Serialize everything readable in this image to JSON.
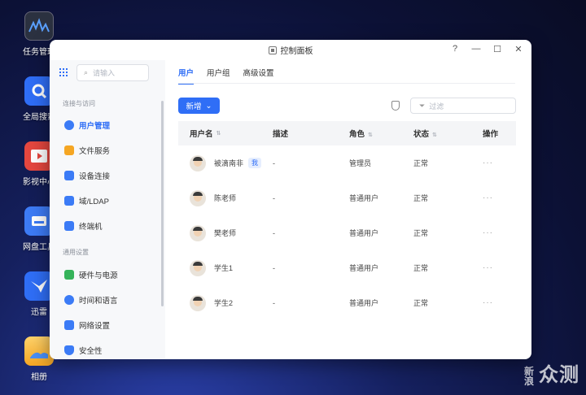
{
  "desktop": {
    "icons": [
      {
        "label": "任务管理",
        "color": "#2b3140"
      },
      {
        "label": "全局搜索",
        "color": "#2f6ef6"
      },
      {
        "label": "影视中心",
        "color": "#e4473f"
      },
      {
        "label": "网盘工具",
        "color": "#3d7bf5"
      },
      {
        "label": "迅雷",
        "color": "#2f6ef6"
      },
      {
        "label": "相册",
        "color": "#f5a623"
      }
    ],
    "watermark_small": "新浪",
    "watermark_big": "众测"
  },
  "window": {
    "title": "控制面板",
    "controls": {
      "help": "?",
      "minimize": "—",
      "maximize": "☐",
      "close": "✕"
    }
  },
  "sidebar": {
    "search_placeholder": "请输入",
    "group1_title": "连接与访问",
    "group2_title": "通用设置",
    "items": [
      {
        "label": "用户管理",
        "icon": "user-icon",
        "color": "#3b7bf6",
        "active": true
      },
      {
        "label": "文件服务",
        "icon": "folder-icon",
        "color": "#f5a623"
      },
      {
        "label": "设备连接",
        "icon": "device-icon",
        "color": "#3b7bf6"
      },
      {
        "label": "域/LDAP",
        "icon": "domain-icon",
        "color": "#3b7bf6"
      },
      {
        "label": "终端机",
        "icon": "terminal-icon",
        "color": "#3b7bf6"
      },
      {
        "label": "硬件与电源",
        "icon": "battery-icon",
        "color": "#35b35a"
      },
      {
        "label": "时间和语言",
        "icon": "clock-icon",
        "color": "#3b7bf6"
      },
      {
        "label": "网络设置",
        "icon": "network-icon",
        "color": "#3b7bf6"
      },
      {
        "label": "安全性",
        "icon": "shield-icon",
        "color": "#3b7bf6"
      }
    ]
  },
  "tabs": [
    {
      "label": "用户",
      "active": true
    },
    {
      "label": "用户组"
    },
    {
      "label": "高级设置"
    }
  ],
  "toolbar": {
    "new_button": "新增",
    "new_caret": "⌄",
    "filter_placeholder": "过滤"
  },
  "table": {
    "headers": {
      "name": "用户名",
      "desc": "描述",
      "role": "角色",
      "status": "状态",
      "action": "操作"
    },
    "sort_glyph": "⇅",
    "rows": [
      {
        "name": "被滴南非",
        "badge": "我",
        "desc": "-",
        "role": "管理员",
        "status": "正常",
        "action": "···"
      },
      {
        "name": "陈老师",
        "desc": "-",
        "role": "普通用户",
        "status": "正常",
        "action": "···"
      },
      {
        "name": "樊老师",
        "desc": "-",
        "role": "普通用户",
        "status": "正常",
        "action": "···"
      },
      {
        "name": "学生1",
        "desc": "-",
        "role": "普通用户",
        "status": "正常",
        "action": "···"
      },
      {
        "name": "学生2",
        "desc": "-",
        "role": "普通用户",
        "status": "正常",
        "action": "···"
      }
    ]
  }
}
